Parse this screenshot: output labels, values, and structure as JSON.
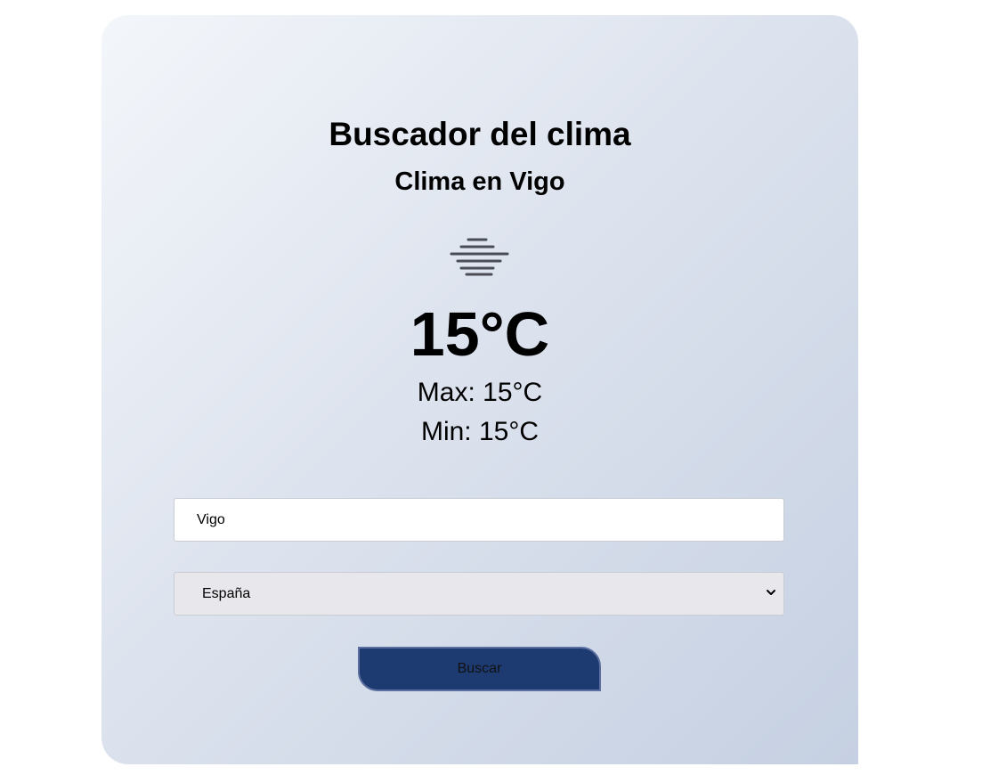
{
  "app": {
    "title": "Buscador del clima",
    "subtitle": "Clima en Vigo"
  },
  "weather": {
    "icon": "fog-icon",
    "temperature": "15°C",
    "max": "Max: 15°C",
    "min": "Min: 15°C"
  },
  "form": {
    "city_value": "Vigo",
    "country_selected": "España",
    "search_label": "Buscar"
  },
  "colors": {
    "button": "#1d3b71",
    "icon": "#4a4d55"
  }
}
